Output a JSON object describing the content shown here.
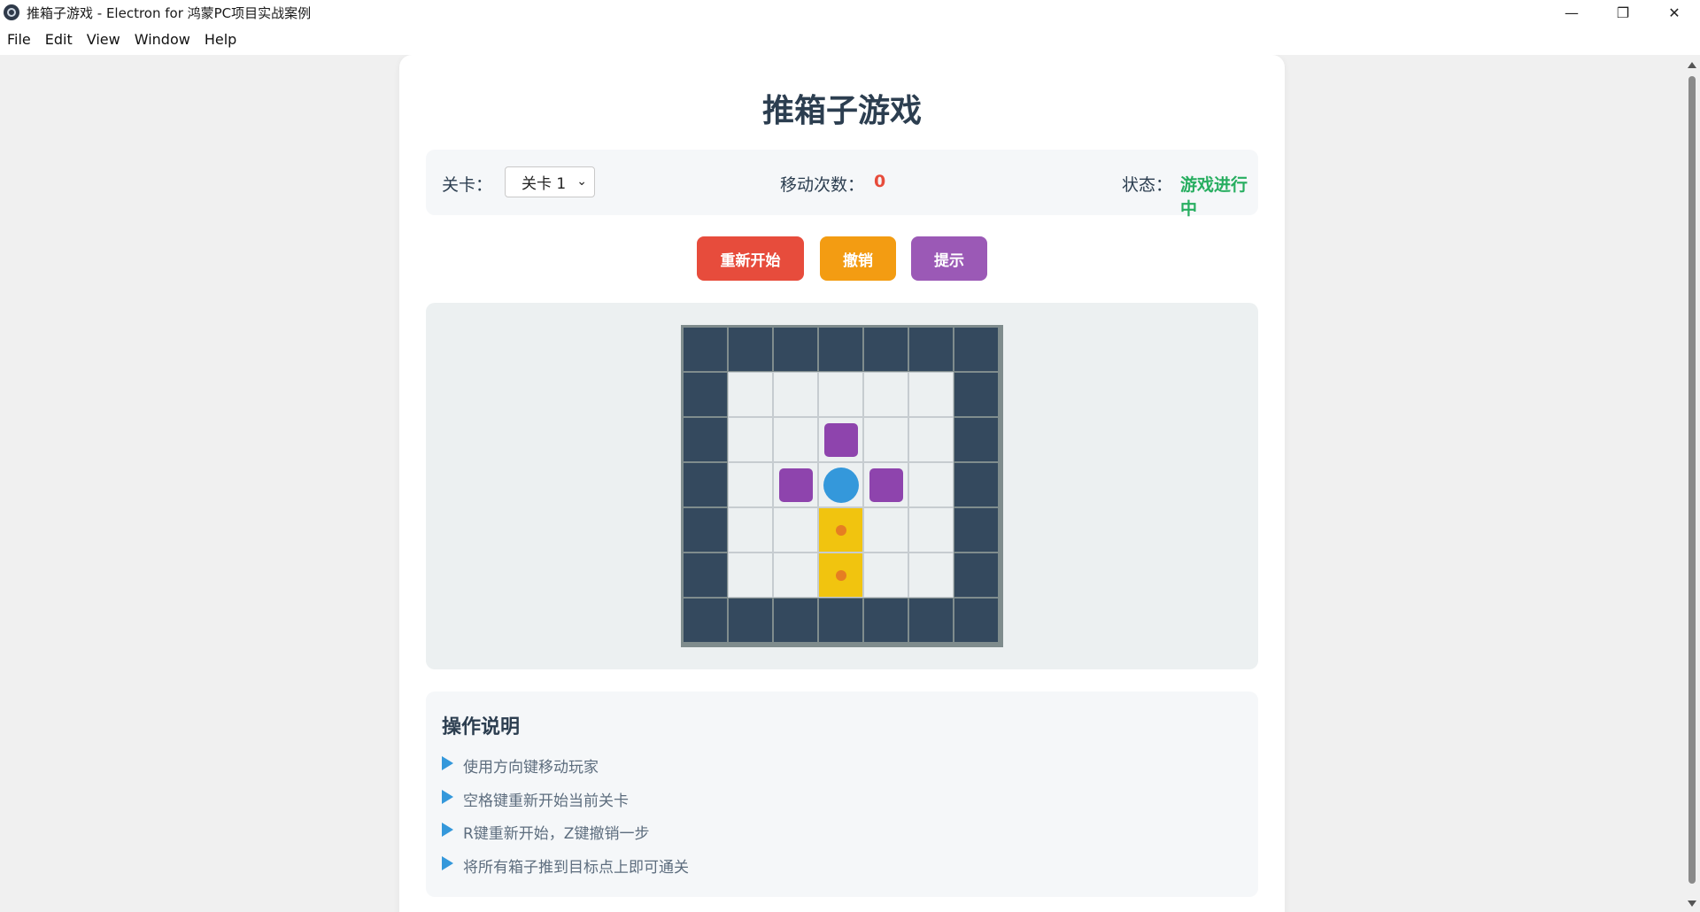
{
  "window": {
    "title": "推箱子游戏 - Electron for 鸿蒙PC项目实战案例",
    "controls": [
      "minimize-icon",
      "restore-icon",
      "close-icon"
    ]
  },
  "menu": [
    "File",
    "Edit",
    "View",
    "Window",
    "Help"
  ],
  "game": {
    "title": "推箱子游戏",
    "level_label": "关卡：",
    "level_selected": "关卡 1",
    "moves_label": "移动次数：",
    "moves_value": "0",
    "status_label": "状态：",
    "status_value": "游戏进行中",
    "buttons": {
      "restart": "重新开始",
      "undo": "撤销",
      "hint": "提示"
    },
    "board": [
      "#######",
      "#     #",
      "#  B  #",
      "# BPB #",
      "#  T  #",
      "#  T  #",
      "#######"
    ],
    "board_legend": {
      "#": "wall",
      " ": "floor",
      "B": "box",
      "P": "player",
      "T": "target"
    },
    "colors": {
      "wall": "#34495e",
      "floor": "#ecf0f1",
      "box": "#8e44ad",
      "player": "#3498db",
      "target": "#f1c40f",
      "target_dot": "#e67e22",
      "restart": "#e74c3c",
      "undo": "#f39c12",
      "hint": "#9b59b6",
      "status": "#27ae60",
      "moves": "#e74c3c"
    }
  },
  "instructions": {
    "title": "操作说明",
    "items": [
      "使用方向键移动玩家",
      "空格键重新开始当前关卡",
      "R键重新开始，Z键撤销一步",
      "将所有箱子推到目标点上即可通关"
    ]
  }
}
